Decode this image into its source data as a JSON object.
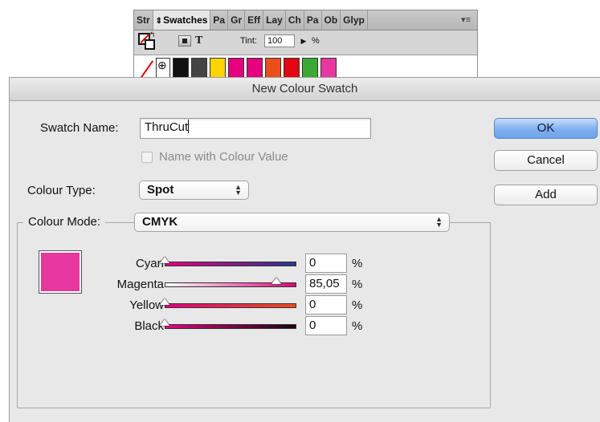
{
  "panel": {
    "tabs": [
      {
        "label": "Str"
      },
      {
        "label": "Swatches",
        "active": true
      },
      {
        "label": "Pa"
      },
      {
        "label": "Gr"
      },
      {
        "label": "Eff"
      },
      {
        "label": "Lay"
      },
      {
        "label": "Ch"
      },
      {
        "label": "Pa"
      },
      {
        "label": "Ob"
      },
      {
        "label": "Glyp"
      }
    ],
    "menu_icon": "≡",
    "tint_label": "Tint:",
    "tint_value": "100",
    "tint_unit": "%",
    "swatches": [
      {
        "color": "#111111"
      },
      {
        "color": "#444444"
      },
      {
        "color": "#ffd400"
      },
      {
        "color": "#e4007f"
      },
      {
        "color": "#e4007f"
      },
      {
        "color": "#e94e1b"
      },
      {
        "color": "#e30613"
      },
      {
        "color": "#3aaa35"
      },
      {
        "color": "#e6389f"
      }
    ]
  },
  "dialog": {
    "title": "New Colour Swatch",
    "swatch_name_label": "Swatch Name:",
    "swatch_name_value": "ThruCut",
    "name_with_colour_value_label": "Name with Colour Value",
    "colour_type_label": "Colour Type:",
    "colour_type_value": "Spot",
    "colour_mode_label": "Colour Mode:",
    "colour_mode_value": "CMYK",
    "buttons": {
      "ok": "OK",
      "cancel": "Cancel",
      "add": "Add"
    },
    "preview_color": "#e6389f",
    "sliders": [
      {
        "key": "cyan",
        "label": "Cyan",
        "value": "0",
        "fraction": 0,
        "gradient": [
          "#e4007f",
          "#2a3590"
        ]
      },
      {
        "key": "magenta",
        "label": "Magenta",
        "value": "85,05",
        "fraction": 0.8505,
        "gradient": [
          "#ffffff",
          "#e4007f"
        ]
      },
      {
        "key": "yellow",
        "label": "Yellow",
        "value": "0",
        "fraction": 0,
        "gradient": [
          "#e4007f",
          "#e94e1b"
        ]
      },
      {
        "key": "black",
        "label": "Black",
        "value": "0",
        "fraction": 0,
        "gradient": [
          "#e4007f",
          "#1a0010"
        ]
      }
    ],
    "unit": "%"
  }
}
